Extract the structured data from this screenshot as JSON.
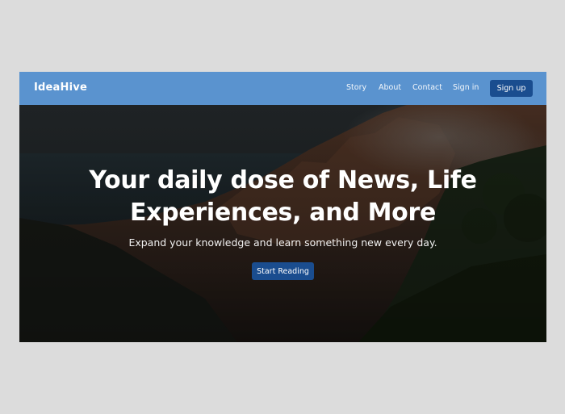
{
  "brand": {
    "name": "IdeaHive"
  },
  "nav": {
    "links": [
      "Story",
      "About",
      "Contact",
      "Sign in"
    ],
    "signup_label": "Sign up"
  },
  "hero": {
    "title_line1": "Your daily dose of News, Life",
    "title_line2": "Experiences, and More",
    "subtitle": "Expand your knowledge and learn something new every day.",
    "cta_label": "Start Reading"
  },
  "colors": {
    "navbar": "#5a93cf",
    "button": "#1a4d8f",
    "page_bg": "#dcdcdc"
  }
}
